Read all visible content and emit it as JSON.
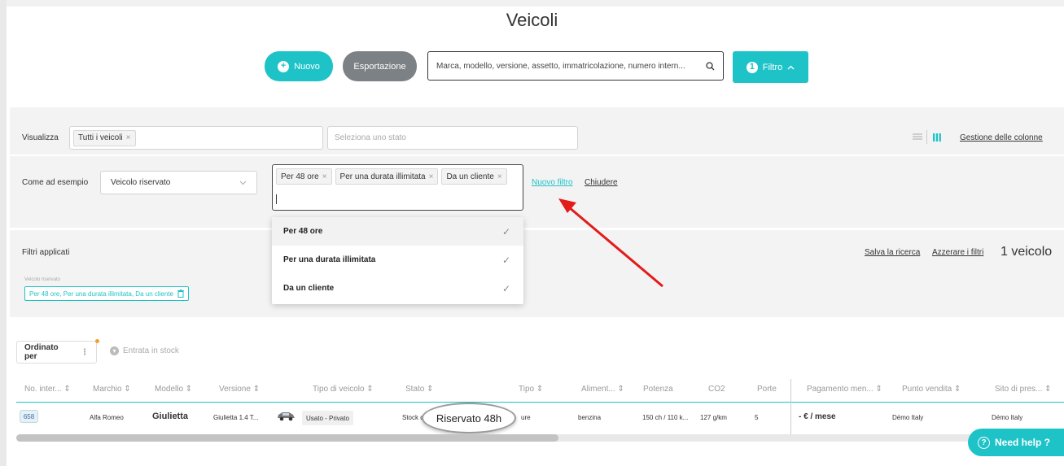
{
  "page": {
    "title": "Veicoli"
  },
  "toolbar": {
    "new_label": "Nuovo",
    "export_label": "Esportazione",
    "search_text": "Marca, modello, versione, assetto, immatricolazione, numero intern...",
    "filter_label": "Filtro",
    "filter_count": "1"
  },
  "view_bar": {
    "label": "Visualizza",
    "chip": "Tutti i veicoli",
    "state_placeholder": "Seleziona uno stato",
    "columns_link": "Gestione delle colonne"
  },
  "filter_bar": {
    "label": "Come ad esempio",
    "select_value": "Veicolo riservato",
    "chips": [
      "Per 48 ore",
      "Per una durata illimitata",
      "Da un cliente"
    ],
    "new_filter_link": "Nuovo filtro",
    "close_link": "Chiudere"
  },
  "dropdown": {
    "options": [
      "Per 48 ore",
      "Per una durata illimitata",
      "Da un cliente"
    ]
  },
  "applied": {
    "label": "Filtri applicati",
    "save_link": "Salva la ricerca",
    "reset_link": "Azzerare i filtri",
    "count": "1 veicolo",
    "tag_title": "Veicolo riservato",
    "tag_value": "Per 48 ore, Per una durata illimitata, Da un cliente"
  },
  "sort": {
    "label": "Ordinato per",
    "stock_label": "Entrata in stock"
  },
  "table": {
    "headers": [
      "No. inter...",
      "Marchio",
      "Modello",
      "Versione",
      "Tipo di veicolo",
      "Stato",
      "Tipo",
      "Aliment...",
      "Potenza",
      "CO2",
      "Porte",
      "Pagamento men...",
      "Punto vendita",
      "Sito di pres..."
    ],
    "row": {
      "id": "658",
      "marchio": "Alfa Romeo",
      "modello": "Giulietta",
      "versione": "Giulietta 1.4 T...",
      "tipo_veicolo": "Usato - Privato",
      "stato": "Stock di",
      "tipo": "ure",
      "alimentazione": "benzina",
      "potenza": "150 ch / 110 k...",
      "co2": "127 g/km",
      "porte": "5",
      "pagamento": "- € / mese",
      "punto_vendita": "Démo Italy",
      "sito": "Démo Italy"
    },
    "highlight": "Riservato 48h"
  },
  "help": {
    "label": "Need help ?"
  },
  "colors": {
    "accent": "#1ec3c8",
    "arrow": "#e31b1b"
  }
}
